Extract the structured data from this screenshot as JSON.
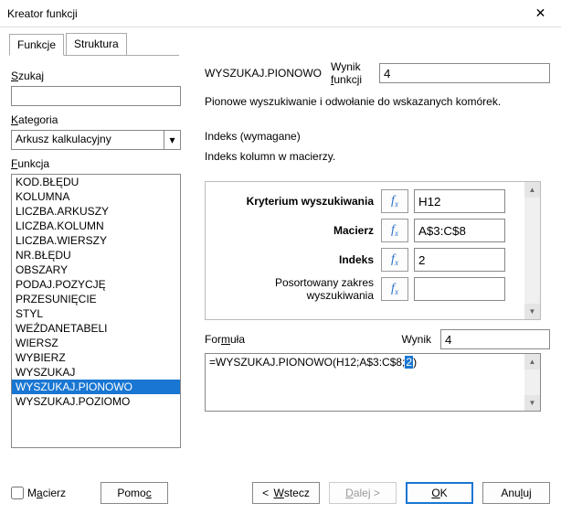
{
  "window": {
    "title": "Kreator funkcji"
  },
  "tabs": {
    "t1": "Funkcje",
    "t2": "Struktura"
  },
  "left": {
    "search_label": "Szukaj",
    "search_value": "",
    "category_label": "Kategoria",
    "category_value": "Arkusz kalkulacyjny",
    "function_label": "Funkcja",
    "items": [
      "KOD.BŁĘDU",
      "KOLUMNA",
      "LICZBA.ARKUSZY",
      "LICZBA.KOLUMN",
      "LICZBA.WIERSZY",
      "NR.BŁĘDU",
      "OBSZARY",
      "PODAJ.POZYCJĘ",
      "PRZESUNIĘCIE",
      "STYL",
      "WEŹDANETABELI",
      "WIERSZ",
      "WYBIERZ",
      "WYSZUKAJ",
      "WYSZUKAJ.PIONOWO",
      "WYSZUKAJ.POZIOMO"
    ],
    "selected_index": 14
  },
  "right": {
    "funcname": "WYSZUKAJ.PIONOWO",
    "result_label": "Wynik funkcji",
    "result_value": "4",
    "desc": "Pionowe wyszukiwanie i odwołanie do wskazanych komórek.",
    "indeks_title": "Indeks (wymagane)",
    "indeks_desc": "Indeks kolumn w macierzy.",
    "params": {
      "p1_label": "Kryterium wyszukiwania",
      "p1_value": "H12",
      "p2_label": "Macierz",
      "p2_value": "A$3:C$8",
      "p3_label": "Indeks",
      "p3_value": "2",
      "p4_label": "Posortowany zakres wyszukiwania",
      "p4_value": ""
    },
    "formula_label": "Formuła",
    "wynik_label": "Wynik",
    "wynik_value": "4",
    "formula_pre": "=WYSZUKAJ.PIONOWO(H12;A$3:C$8;",
    "formula_sel": "2",
    "formula_post": ")"
  },
  "footer": {
    "array_label": "Macierz",
    "help": "Pomoc",
    "back": "Wstecz",
    "next": "Dalej >",
    "ok": "OK",
    "cancel": "Anuluj"
  }
}
